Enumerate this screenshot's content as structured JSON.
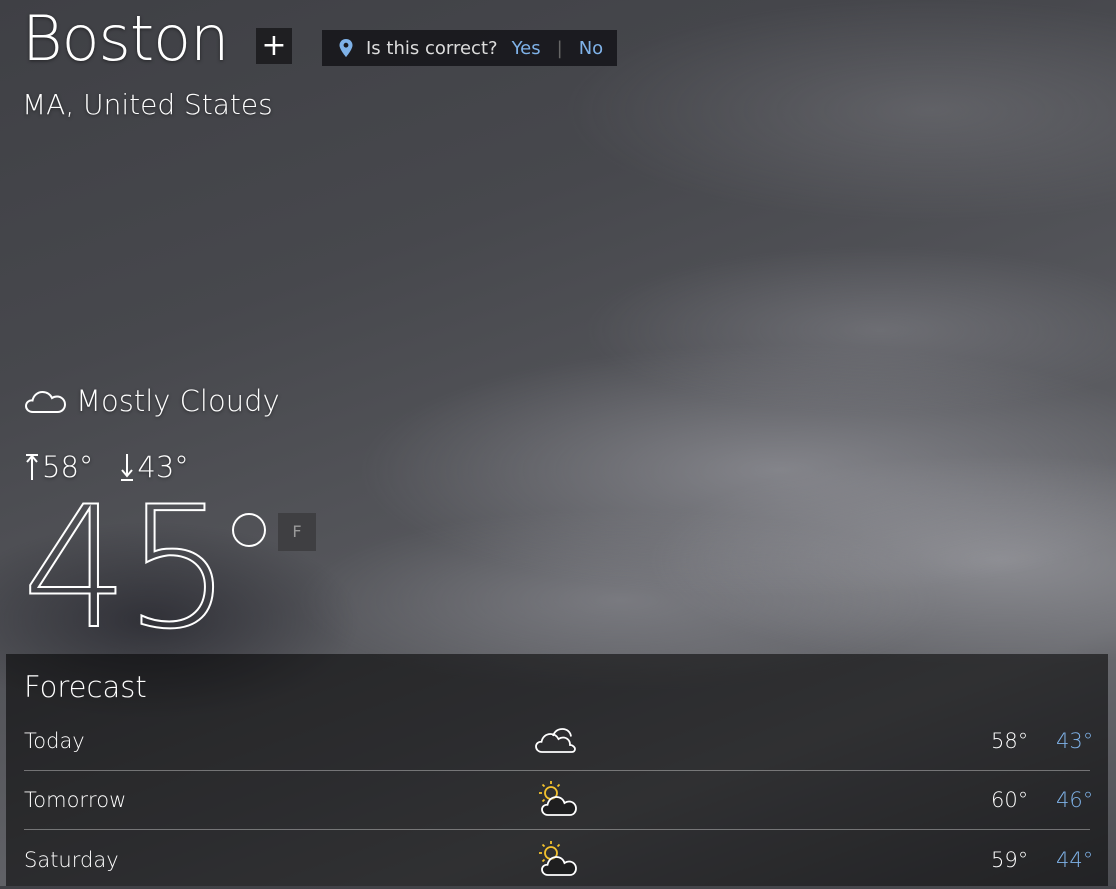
{
  "location": {
    "city": "Boston",
    "region": "MA, United States",
    "add_label": "+",
    "confirm": {
      "question": "Is this correct?",
      "yes": "Yes",
      "separator": "|",
      "no": "No"
    }
  },
  "current": {
    "condition": "Mostly Cloudy",
    "condition_icon": "cloud-icon",
    "high": "58°",
    "low": "43°",
    "temperature": "45",
    "unit": "F"
  },
  "forecast": {
    "title": "Forecast",
    "days": [
      {
        "day": "Today",
        "icon": "cloud-icon",
        "high": "58°",
        "low": "43°"
      },
      {
        "day": "Tomorrow",
        "icon": "partly-sunny-icon",
        "high": "60°",
        "low": "46°"
      },
      {
        "day": "Saturday",
        "icon": "partly-sunny-icon",
        "high": "59°",
        "low": "44°"
      }
    ]
  },
  "colors": {
    "accent": "#7fb2e8",
    "sun": "#f2c12e"
  }
}
